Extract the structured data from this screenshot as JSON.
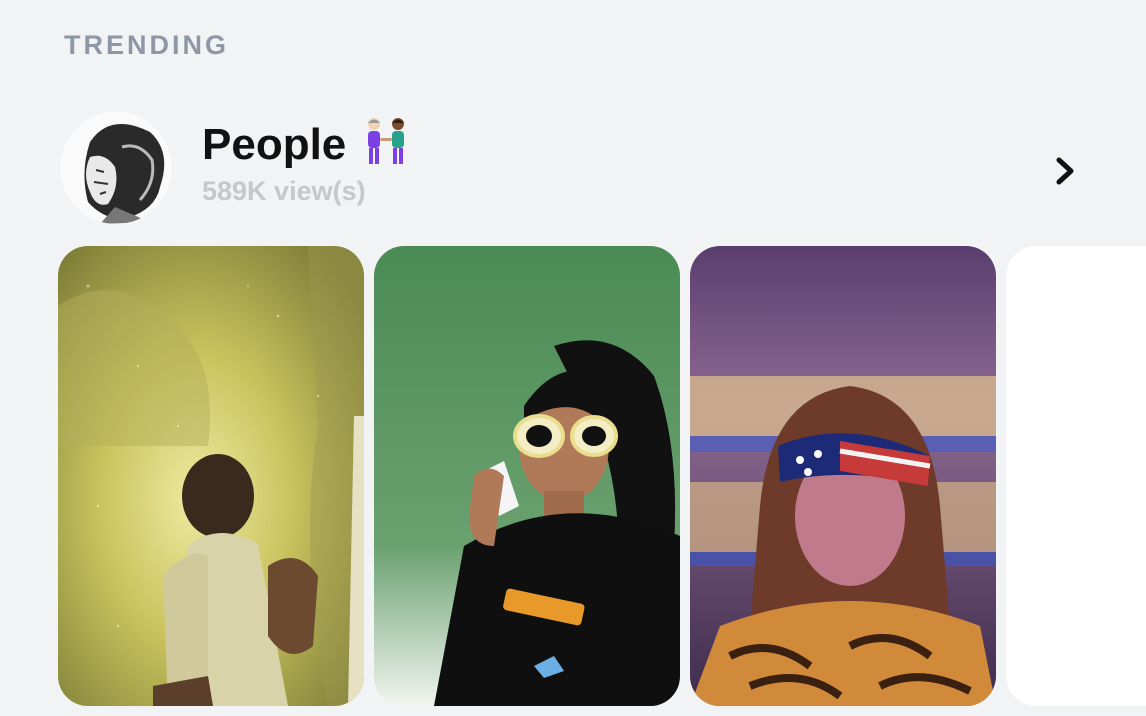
{
  "section": {
    "title": "TRENDING"
  },
  "category": {
    "name": "People",
    "emoji": "👭",
    "views": "589K view(s)"
  },
  "icons": {
    "avatar": "profile-sketch",
    "more": "chevron-right-icon",
    "emoji": "two-people-holding-hands"
  },
  "cards": [
    {
      "subject": "man-in-yellow-glow"
    },
    {
      "subject": "woman-with-sunglasses-on-phone"
    },
    {
      "subject": "girl-with-flag-blindfold"
    },
    {
      "subject": "blank"
    }
  ]
}
